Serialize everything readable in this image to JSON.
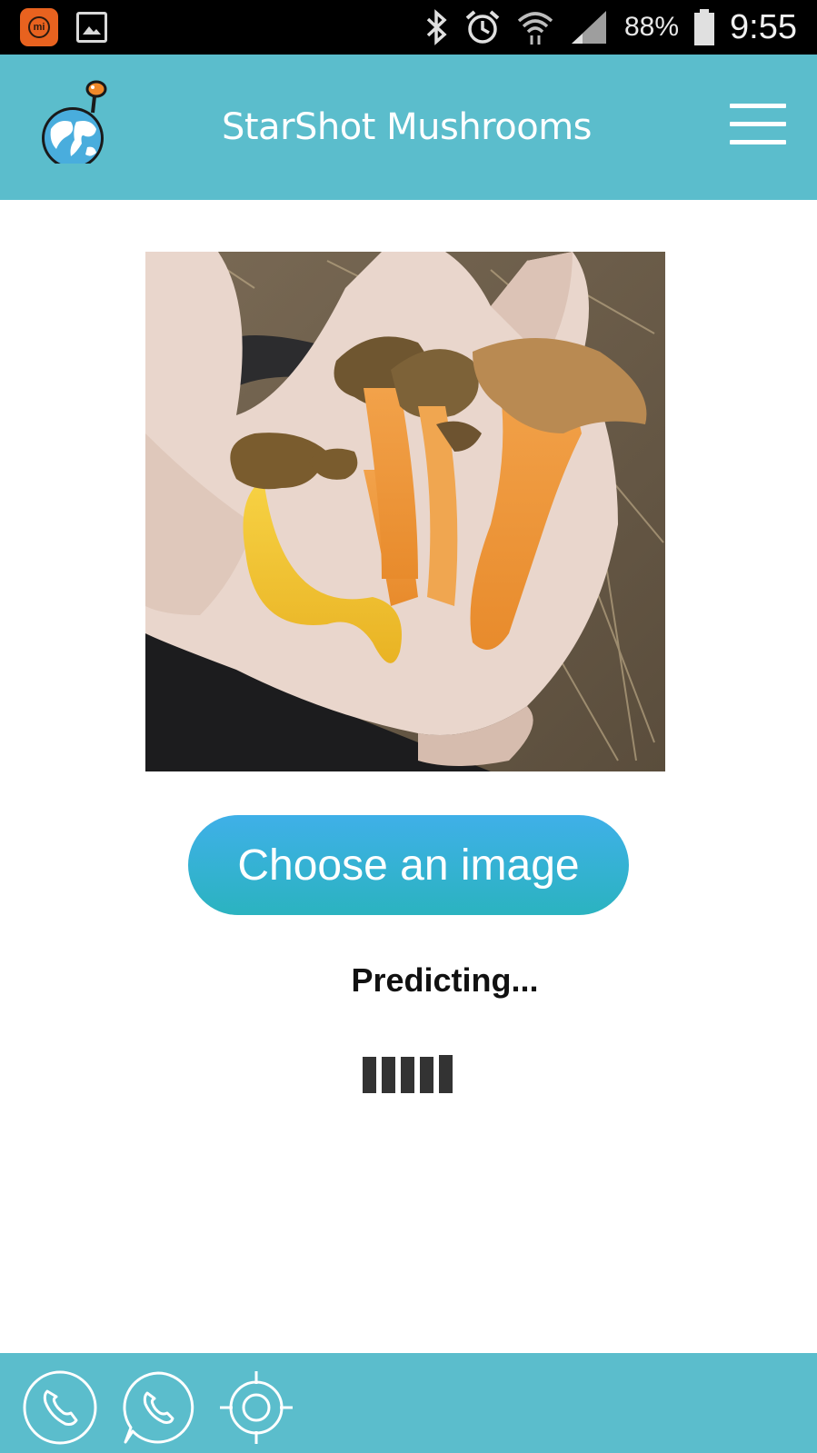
{
  "status_bar": {
    "left_icons": [
      "mi-app-icon",
      "gallery-icon"
    ],
    "right_icons": [
      "bluetooth-icon",
      "alarm-icon",
      "wifi-icon",
      "signal-icon",
      "battery-icon"
    ],
    "battery": "88%",
    "clock": "9:55"
  },
  "header": {
    "title": "StarShot Mushrooms",
    "logo_icon": "globe-logo-icon",
    "menu_icon": "hamburger-menu-icon",
    "background": "#5bbdcc"
  },
  "main": {
    "image_subject": "mushroom-photo",
    "choose_button_label": "Choose an image",
    "status_text": "Predicting...",
    "loader_icon": "loading-bars-icon"
  },
  "bottom_bar": {
    "icons": [
      "phone-icon",
      "whatsapp-icon",
      "location-target-icon"
    ],
    "background": "#5bbdcc"
  },
  "colors": {
    "accent": "#5bbdcc",
    "button_top": "#3fb0e8",
    "button_bottom": "#2bb3c0"
  }
}
